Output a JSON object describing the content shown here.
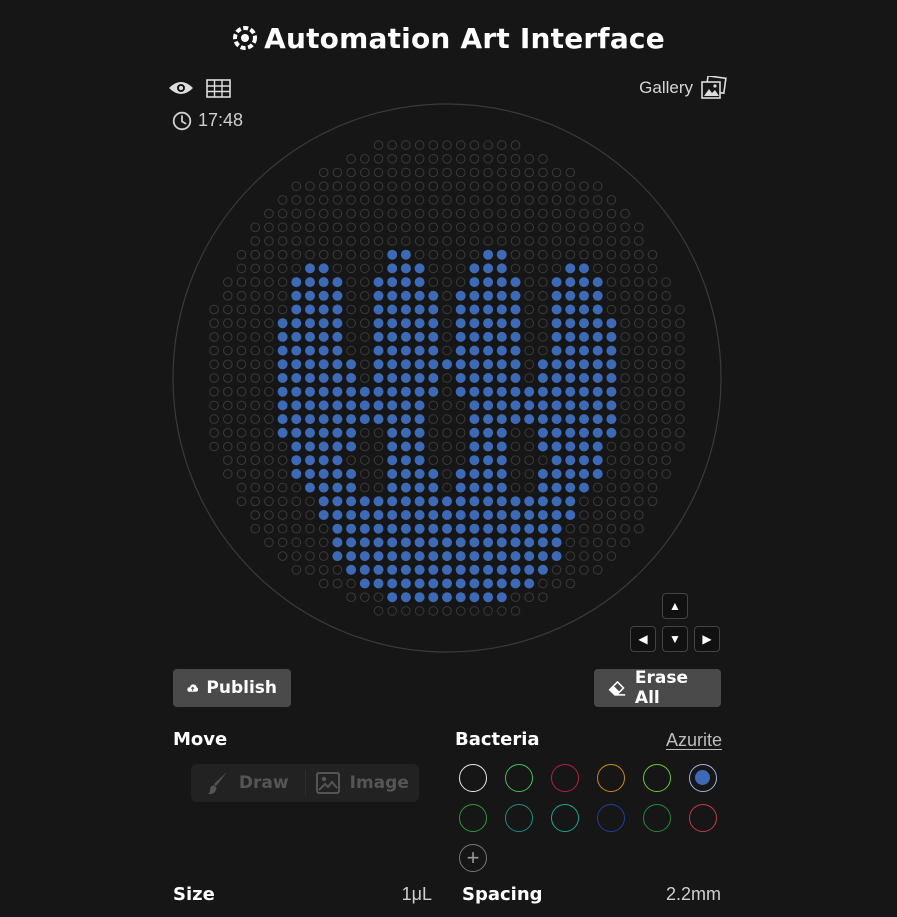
{
  "header": {
    "title": "Automation Art Interface",
    "logo_icon": "gear-flower-icon"
  },
  "toolbar": {
    "visibility_icon": "eye-icon",
    "grid_icon": "grid-icon",
    "gallery_label": "Gallery",
    "gallery_icon": "images-icon",
    "time": "17:48",
    "time_icon": "clock-icon"
  },
  "plate": {
    "well_color": "#3d6ab7",
    "empty_well_color": "#3a3a3a",
    "rim_color": "#3a3a3a"
  },
  "nav": {
    "up": "▲",
    "left": "◀",
    "down": "▼",
    "right": "▶"
  },
  "actions": {
    "publish_label": "Publish",
    "publish_icon": "cloud-upload-icon",
    "erase_label": "Erase All",
    "erase_icon": "eraser-icon"
  },
  "move": {
    "label": "Move",
    "draw_label": "Draw",
    "image_label": "Image"
  },
  "bacteria": {
    "label": "Bacteria",
    "selected_name": "Azurite",
    "swatches": [
      {
        "color": "#e8e8e8",
        "selected": false
      },
      {
        "color": "#3fc25b",
        "selected": false
      },
      {
        "color": "#b3223d",
        "selected": false
      },
      {
        "color": "#c98a16",
        "selected": false
      },
      {
        "color": "#6acb2b",
        "selected": false
      },
      {
        "color": "#3d6ab7",
        "selected": true
      },
      {
        "color": "#2e9a3a",
        "selected": false
      },
      {
        "color": "#1e8a83",
        "selected": false
      },
      {
        "color": "#1aa59c",
        "selected": false
      },
      {
        "color": "#1e3f9c",
        "selected": false
      },
      {
        "color": "#1f8a3d",
        "selected": false
      },
      {
        "color": "#c53a48",
        "selected": false
      }
    ],
    "add_label": "+"
  },
  "size": {
    "label": "Size",
    "value": "1μL"
  },
  "spacing": {
    "label": "Spacing",
    "value": "2.2mm"
  }
}
